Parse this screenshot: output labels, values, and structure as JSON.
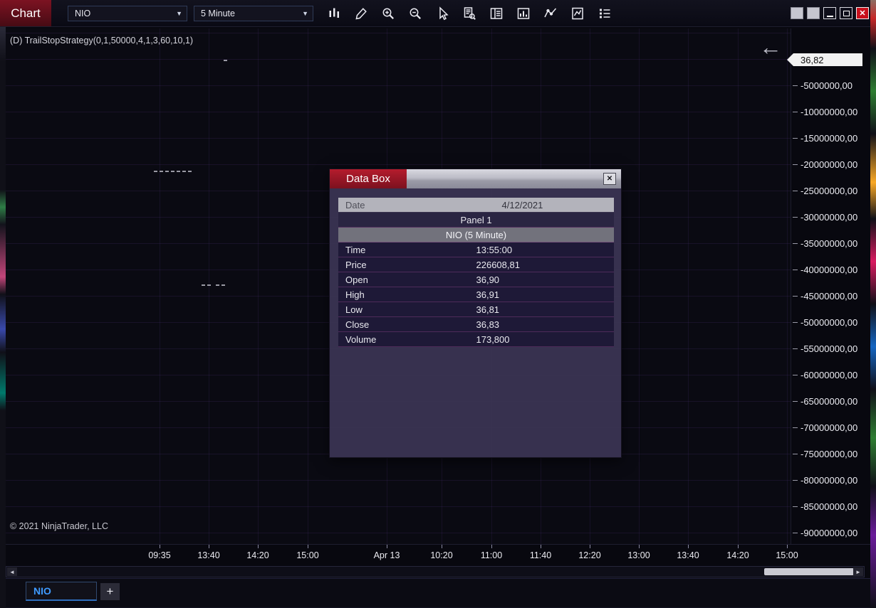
{
  "titlebar": {
    "app_tab": "Chart",
    "instrument": "NIO",
    "interval": "5 Minute",
    "dropdown_arrow": "▼"
  },
  "toolbar": {
    "icons": [
      "chart-style",
      "draw",
      "zoom-in",
      "zoom-out",
      "cursor",
      "data-box",
      "chart-trader",
      "indicators",
      "signal",
      "strategies",
      "properties"
    ]
  },
  "window_controls": {
    "close": "✕"
  },
  "chart": {
    "strategy_label": "(D) TrailStopStrategy(0,1,50000,4,1,3,60,10,1)",
    "copyright": "© 2021 NinjaTrader, LLC",
    "price_marker": "36,82",
    "arrow": "←",
    "y_axis": [
      "-5000000,00",
      "-10000000,00",
      "-15000000,00",
      "-20000000,00",
      "-25000000,00",
      "-30000000,00",
      "-35000000,00",
      "-40000000,00",
      "-45000000,00",
      "-50000000,00",
      "-55000000,00",
      "-60000000,00",
      "-65000000,00",
      "-70000000,00",
      "-75000000,00",
      "-80000000,00",
      "-85000000,00",
      "-90000000,00"
    ],
    "x_axis": [
      "09:35",
      "13:40",
      "14:20",
      "15:00",
      "Apr 13",
      "10:20",
      "11:00",
      "11:40",
      "12:20",
      "13:00",
      "13:40",
      "14:20",
      "15:00"
    ]
  },
  "data_box": {
    "title": "Data Box",
    "close_glyph": "✕",
    "rows": [
      {
        "label": "Date",
        "value": "4/12/2021"
      },
      {
        "label": "Panel 1",
        "value": ""
      },
      {
        "label": "NIO (5 Minute)",
        "value": ""
      },
      {
        "label": "Time",
        "value": "13:55:00"
      },
      {
        "label": "Price",
        "value": "226608,81"
      },
      {
        "label": "Open",
        "value": "36,90"
      },
      {
        "label": "High",
        "value": "36,91"
      },
      {
        "label": "Low",
        "value": "36,81"
      },
      {
        "label": "Close",
        "value": "36,83"
      },
      {
        "label": "Volume",
        "value": "173,800"
      }
    ]
  },
  "scrollbar": {
    "left_arrow": "◄",
    "right_arrow": "►"
  },
  "tabs": {
    "nio": "NIO",
    "add": "+"
  },
  "colors": {
    "accent_red": "#8e1622",
    "tab_blue": "#3f9bff",
    "grid_purple": "#6e46aa",
    "marker_bg": "#f2f2f2"
  }
}
